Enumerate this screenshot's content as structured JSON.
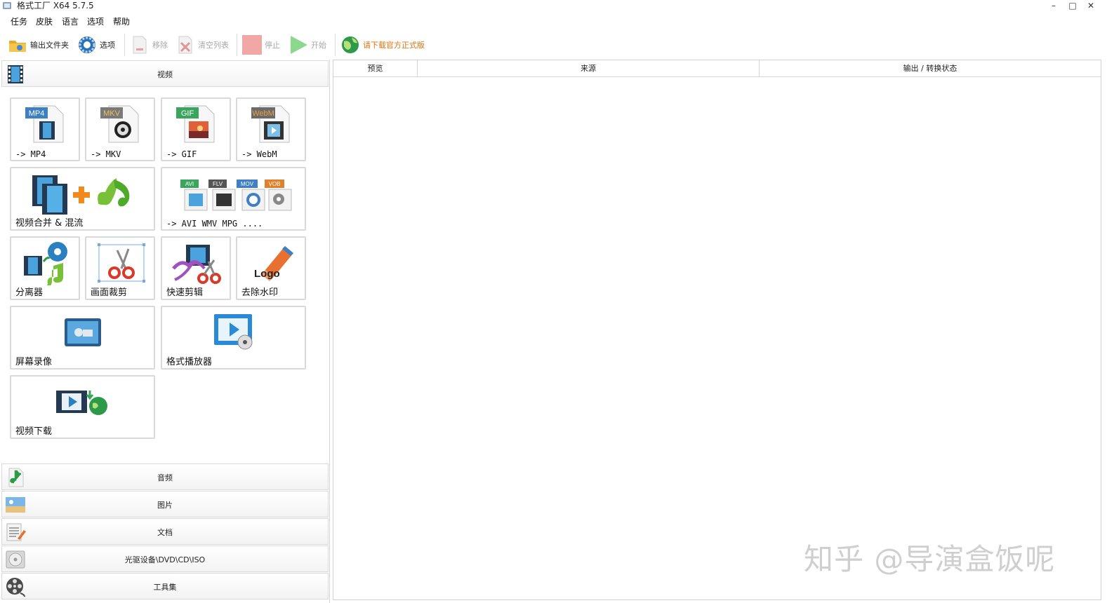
{
  "window": {
    "title": "格式工厂 X64 5.7.5",
    "minimize": "–",
    "maximize": "□",
    "close": "✕"
  },
  "menu": [
    "任务",
    "皮肤",
    "语言",
    "选项",
    "帮助"
  ],
  "toolbar": {
    "output_folder": "输出文件夹",
    "options": "选项",
    "remove": "移除",
    "clear_list": "清空列表",
    "stop": "停止",
    "start": "开始",
    "download_official": "请下载官方正式版"
  },
  "categories": {
    "video": "视频",
    "audio": "音频",
    "image": "图片",
    "document": "文档",
    "optical": "光驱设备\\DVD\\CD\\ISO",
    "tools": "工具集"
  },
  "tiles": {
    "mp4": "-> MP4",
    "mkv": "-> MKV",
    "gif": "-> GIF",
    "webm": "-> WebM",
    "merge": "视频合并 & 混流",
    "others": "-> AVI WMV MPG ....",
    "splitter": "分离器",
    "crop": "画面裁剪",
    "quick_cut": "快速剪辑",
    "remove_watermark": "去除水印",
    "screen_record": "屏幕录像",
    "player": "格式播放器",
    "video_download": "视频下载"
  },
  "badges": {
    "mp4": "MP4",
    "mkv": "MKV",
    "gif": "GIF",
    "webm": "WebM",
    "avi": "AVI",
    "flv": "FLV",
    "mov": "MOV",
    "vob": "VOB",
    "logo": "Logo"
  },
  "table": {
    "columns": [
      "预览",
      "来源",
      "输出 / 转换状态"
    ]
  },
  "watermark": "知乎 @导演盒饭呢",
  "colors": {
    "mp4_badge": "#3f7fc4",
    "mkv_badge": "#7a7a7a",
    "gif_badge": "#3aa55c",
    "webm_badge": "#e0802a",
    "promo_text": "#e0720f"
  }
}
